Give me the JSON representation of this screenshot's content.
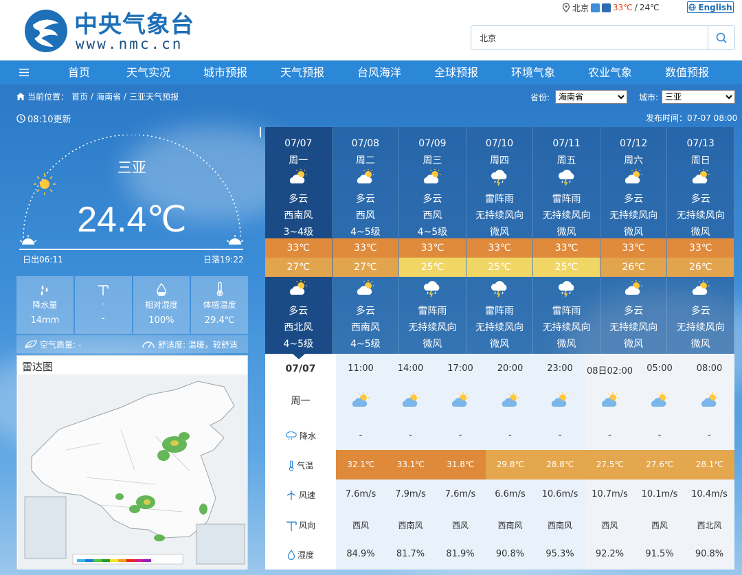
{
  "header": {
    "site_name": "中央气象台",
    "site_url": "www.nmc.cn",
    "top_city": "北京",
    "top_high": "33℃",
    "top_sep": "/",
    "top_low": "24℃",
    "english_label": "English",
    "search_value": "北京"
  },
  "nav": {
    "items": [
      "首页",
      "天气实况",
      "城市预报",
      "天气预报",
      "台风海洋",
      "全球预报",
      "环境气象",
      "农业气象",
      "数值预报"
    ]
  },
  "breadcrumb": {
    "prefix": "当前位置：",
    "home": "首页",
    "sep": "/",
    "province": "海南省",
    "page": "三亚天气预报"
  },
  "selectors": {
    "province_label": "省份:",
    "province_value": "海南省",
    "city_label": "城市:",
    "city_value": "三亚"
  },
  "update_time": "08:10更新",
  "publish_time": "发布时间：07-07 08:00",
  "current": {
    "city": "三亚",
    "temp": "24.4℃",
    "sunrise": "日出06:11",
    "sunset": "日落19:22",
    "metrics": [
      {
        "label": "降水量",
        "value": "14mm",
        "icon": "raindrops-icon"
      },
      {
        "label": "-",
        "value": "-",
        "icon": "wind-turbine-icon"
      },
      {
        "label": "相对湿度",
        "value": "100%",
        "icon": "humidity-drop-icon"
      },
      {
        "label": "体感温度",
        "value": "29.4℃",
        "icon": "thermometer-icon"
      }
    ],
    "air_quality": "空气质量: -",
    "comfort": "舒适度: 温暖，较舒适"
  },
  "radar": {
    "title": "雷达图"
  },
  "forecast": {
    "days": [
      {
        "date": "07/07",
        "week": "周一",
        "desc1": "多云",
        "wdir1": "西南风",
        "wpow1": "3~4级",
        "hi": "33℃",
        "lo": "27℃",
        "desc2": "多云",
        "wdir2": "西北风",
        "wpow2": "4~5级",
        "icon1": "partly-cloudy",
        "icon2": "partly-cloudy"
      },
      {
        "date": "07/08",
        "week": "周二",
        "desc1": "多云",
        "wdir1": "西风",
        "wpow1": "4~5级",
        "hi": "33℃",
        "lo": "27℃",
        "desc2": "多云",
        "wdir2": "西南风",
        "wpow2": "4~5级",
        "icon1": "partly-cloudy",
        "icon2": "partly-cloudy"
      },
      {
        "date": "07/09",
        "week": "周三",
        "desc1": "多云",
        "wdir1": "西风",
        "wpow1": "4~5级",
        "hi": "33℃",
        "lo": "25℃",
        "desc2": "雷阵雨",
        "wdir2": "无持续风向",
        "wpow2": "微风",
        "icon1": "partly-cloudy",
        "icon2": "thunderstorm"
      },
      {
        "date": "07/10",
        "week": "周四",
        "desc1": "雷阵雨",
        "wdir1": "无持续风向",
        "wpow1": "微风",
        "hi": "33℃",
        "lo": "25℃",
        "desc2": "雷阵雨",
        "wdir2": "无持续风向",
        "wpow2": "微风",
        "icon1": "thunderstorm",
        "icon2": "thunderstorm"
      },
      {
        "date": "07/11",
        "week": "周五",
        "desc1": "雷阵雨",
        "wdir1": "无持续风向",
        "wpow1": "微风",
        "hi": "33℃",
        "lo": "25℃",
        "desc2": "雷阵雨",
        "wdir2": "无持续风向",
        "wpow2": "微风",
        "icon1": "thunderstorm",
        "icon2": "thunderstorm"
      },
      {
        "date": "07/12",
        "week": "周六",
        "desc1": "多云",
        "wdir1": "无持续风向",
        "wpow1": "微风",
        "hi": "33℃",
        "lo": "26℃",
        "desc2": "多云",
        "wdir2": "无持续风向",
        "wpow2": "微风",
        "icon1": "partly-cloudy",
        "icon2": "partly-cloudy"
      },
      {
        "date": "07/13",
        "week": "周日",
        "desc1": "多云",
        "wdir1": "无持续风向",
        "wpow1": "微风",
        "hi": "33℃",
        "lo": "26℃",
        "desc2": "多云",
        "wdir2": "无持续风向",
        "wpow2": "微风",
        "icon1": "partly-cloudy",
        "icon2": "partly-cloudy"
      }
    ],
    "low_colors": [
      "#e3a44e",
      "#e3a44e",
      "#f0d765",
      "#f0d765",
      "#f0d765",
      "#e3a44e",
      "#e3a44e"
    ]
  },
  "hourly": {
    "date": "07/07",
    "week": "周一",
    "row_labels": {
      "rain": "降水",
      "temp": "气温",
      "speed": "风速",
      "dir": "风向",
      "humidity": "湿度"
    },
    "times": [
      "11:00",
      "14:00",
      "17:00",
      "20:00",
      "23:00",
      "08日02:00",
      "05:00",
      "08:00"
    ],
    "rain": [
      "-",
      "-",
      "-",
      "-",
      "-",
      "-",
      "-",
      "-"
    ],
    "temps": [
      "32.1℃",
      "33.1℃",
      "31.8℃",
      "29.8℃",
      "28.8℃",
      "27.5℃",
      "27.6℃",
      "28.1℃"
    ],
    "temp_colors": [
      "#df8a3a",
      "#df8a3a",
      "#df8a3a",
      "#e4a74e",
      "#e4a74e",
      "#e4a74e",
      "#e4a74e",
      "#e4a74e"
    ],
    "speeds": [
      "7.6m/s",
      "7.9m/s",
      "7.6m/s",
      "6.6m/s",
      "10.6m/s",
      "10.7m/s",
      "10.1m/s",
      "10.4m/s"
    ],
    "dirs": [
      "西风",
      "西南风",
      "西风",
      "西南风",
      "西南风",
      "西风",
      "西风",
      "西北风"
    ],
    "humidity": [
      "84.9%",
      "81.7%",
      "81.9%",
      "90.8%",
      "95.3%",
      "92.2%",
      "91.5%",
      "90.8%"
    ]
  }
}
